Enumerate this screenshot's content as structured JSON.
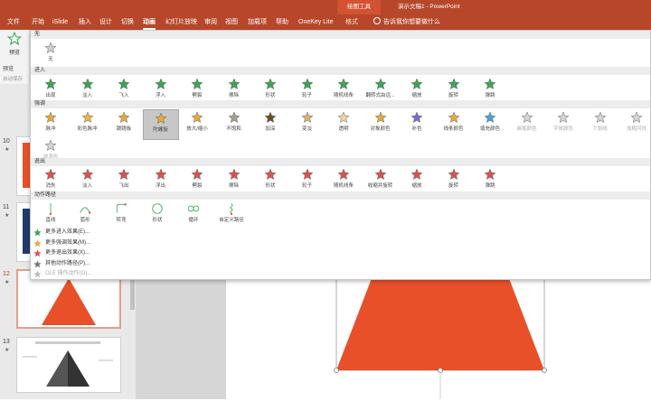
{
  "window": {
    "context_tab": "绘图工具",
    "title": "演示文稿1 - PowerPoint"
  },
  "tabs": [
    {
      "label": "文件"
    },
    {
      "label": "开始"
    },
    {
      "label": "iSlide"
    },
    {
      "label": "插入"
    },
    {
      "label": "设计"
    },
    {
      "label": "切换"
    },
    {
      "label": "动画",
      "active": true
    },
    {
      "label": "幻灯片放映"
    },
    {
      "label": "审阅"
    },
    {
      "label": "视图"
    },
    {
      "label": "加载项"
    },
    {
      "label": "帮助"
    },
    {
      "label": "OneKey Lite"
    },
    {
      "label": "格式",
      "context": true
    }
  ],
  "tell_me": "告诉我你想要做什么",
  "ribbon": {
    "preview_label": "预览",
    "preview_group": "预览",
    "autosave": "自动保存"
  },
  "gallery": {
    "sections": {
      "none": "无",
      "entrance": "进入",
      "emphasis": "强调",
      "exit": "退出",
      "motion": "动作路径"
    },
    "none_items": [
      {
        "label": "无"
      }
    ],
    "entrance_items": [
      {
        "label": "出现"
      },
      {
        "label": "淡入"
      },
      {
        "label": "飞入"
      },
      {
        "label": "浮入"
      },
      {
        "label": "劈裂"
      },
      {
        "label": "擦除"
      },
      {
        "label": "形状"
      },
      {
        "label": "轮子"
      },
      {
        "label": "随机线条"
      },
      {
        "label": "翻转式由远..."
      },
      {
        "label": "缩放"
      },
      {
        "label": "旋转"
      },
      {
        "label": "弹跳"
      }
    ],
    "emphasis_items": [
      {
        "label": "脉冲",
        "color": "#e8a93a"
      },
      {
        "label": "彩色脉冲",
        "color": "#f0b14a"
      },
      {
        "label": "跷跷板",
        "color": "#e8a93a"
      },
      {
        "label": "陀螺旋",
        "color": "#e8a93a",
        "selected": true
      },
      {
        "label": "放大/缩小",
        "color": "#e8a93a"
      },
      {
        "label": "不饱和",
        "color": "#a8a090"
      },
      {
        "label": "加深",
        "color": "#6a5020"
      },
      {
        "label": "变淡",
        "color": "#d8b468"
      },
      {
        "label": "透明",
        "color": "#f3d49a"
      },
      {
        "label": "对象颜色",
        "color": "#e8a93a"
      },
      {
        "label": "补色",
        "color": "#7b6bd8"
      },
      {
        "label": "线条颜色",
        "color": "#e8a93a"
      },
      {
        "label": "填充颜色",
        "color": "#4aa0e0"
      },
      {
        "label": "画笔颜色",
        "color": "#d4d4d4",
        "disabled": true
      },
      {
        "label": "字体颜色",
        "color": "#d4d4d4",
        "disabled": true
      },
      {
        "label": "下划线",
        "color": "#d4d4d4",
        "disabled": true
      },
      {
        "label": "加粗闪烁",
        "color": "#d4d4d4",
        "disabled": true
      },
      {
        "label": "加粗展示",
        "color": "#d4d4d4",
        "disabled": true
      },
      {
        "label": "波浪形",
        "color": "#d4d4d4",
        "disabled": true
      }
    ],
    "exit_items": [
      {
        "label": "消失"
      },
      {
        "label": "淡入"
      },
      {
        "label": "飞出"
      },
      {
        "label": "浮出"
      },
      {
        "label": "劈裂"
      },
      {
        "label": "擦除"
      },
      {
        "label": "形状"
      },
      {
        "label": "轮子"
      },
      {
        "label": "随机线条"
      },
      {
        "label": "收缩并旋转"
      },
      {
        "label": "缩放"
      },
      {
        "label": "旋转"
      },
      {
        "label": "弹跳"
      }
    ],
    "motion_items": [
      {
        "label": "直线",
        "icon": "line-path-icon"
      },
      {
        "label": "弧形",
        "icon": "arc-path-icon"
      },
      {
        "label": "转弯",
        "icon": "turn-path-icon"
      },
      {
        "label": "形状",
        "icon": "shape-path-icon"
      },
      {
        "label": "循环",
        "icon": "loop-path-icon"
      },
      {
        "label": "自定义路径",
        "icon": "custom-path-icon"
      }
    ],
    "more": [
      {
        "label": "更多进入效果(E)...",
        "color": "#3aa655"
      },
      {
        "label": "更多强调效果(M)...",
        "color": "#e8a93a"
      },
      {
        "label": "更多退出效果(X)...",
        "color": "#e05050"
      },
      {
        "label": "其他动作路径(P)...",
        "color": "#777777"
      },
      {
        "label": "OLE 操作动作(O)...",
        "color": "#bbbbbb",
        "disabled": true
      }
    ]
  },
  "thumbnails": [
    {
      "num": "10",
      "star": "★"
    },
    {
      "num": "11",
      "star": "★"
    },
    {
      "num": "12",
      "star": "★",
      "selected": true
    },
    {
      "num": "13",
      "star": "★"
    }
  ],
  "colors": {
    "accent": "#b7472a",
    "shape": "#e8502a",
    "entrance": "#3aa655",
    "emphasis": "#e8a93a",
    "exit": "#e05050"
  }
}
